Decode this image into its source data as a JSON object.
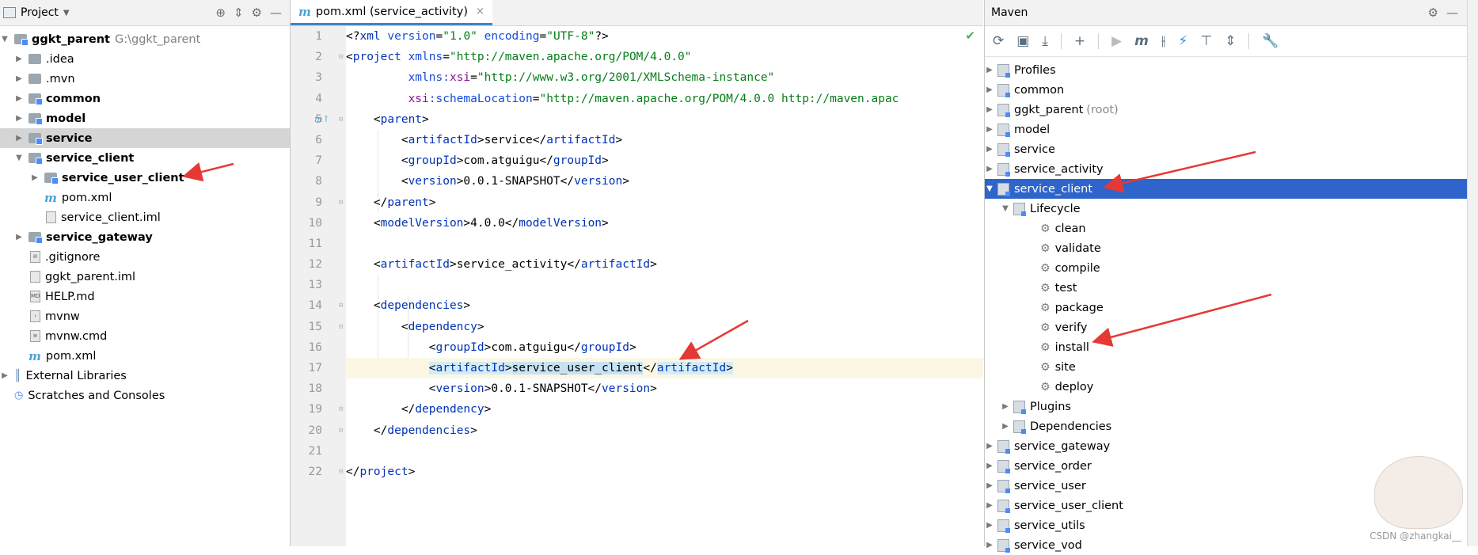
{
  "project": {
    "title": "Project",
    "items": [
      {
        "label": "ggkt_parent",
        "path": "G:\\ggkt_parent"
      },
      {
        "label": ".idea"
      },
      {
        "label": ".mvn"
      },
      {
        "label": "common"
      },
      {
        "label": "model"
      },
      {
        "label": "service"
      },
      {
        "label": "service_client"
      },
      {
        "label": "service_user_client"
      },
      {
        "label": "pom.xml"
      },
      {
        "label": "service_client.iml"
      },
      {
        "label": "service_gateway"
      },
      {
        "label": ".gitignore"
      },
      {
        "label": "ggkt_parent.iml"
      },
      {
        "label": "HELP.md"
      },
      {
        "label": "mvnw"
      },
      {
        "label": "mvnw.cmd"
      },
      {
        "label": "pom.xml"
      },
      {
        "label": "External Libraries"
      },
      {
        "label": "Scratches and Consoles"
      }
    ]
  },
  "editor": {
    "tab_label": "pom.xml (service_activity)",
    "line_numbers": [
      "1",
      "2",
      "3",
      "4",
      "5",
      "6",
      "7",
      "8",
      "9",
      "10",
      "11",
      "12",
      "13",
      "14",
      "15",
      "16",
      "17",
      "18",
      "19",
      "20",
      "21",
      "22"
    ]
  },
  "maven": {
    "title": "Maven",
    "items": [
      {
        "label": "Profiles"
      },
      {
        "label": "common"
      },
      {
        "label": "ggkt_parent",
        "suffix": "(root)"
      },
      {
        "label": "model"
      },
      {
        "label": "service"
      },
      {
        "label": "service_activity"
      },
      {
        "label": "service_client"
      },
      {
        "label": "Lifecycle"
      },
      {
        "label": "clean"
      },
      {
        "label": "validate"
      },
      {
        "label": "compile"
      },
      {
        "label": "test"
      },
      {
        "label": "package"
      },
      {
        "label": "verify"
      },
      {
        "label": "install"
      },
      {
        "label": "site"
      },
      {
        "label": "deploy"
      },
      {
        "label": "Plugins"
      },
      {
        "label": "Dependencies"
      },
      {
        "label": "service_gateway"
      },
      {
        "label": "service_order"
      },
      {
        "label": "service_user"
      },
      {
        "label": "service_user_client"
      },
      {
        "label": "service_utils"
      },
      {
        "label": "service_vod"
      }
    ]
  },
  "watermark": "CSDN @zhangkai__",
  "colors": {
    "selection": "#2f65ca",
    "annotation_arrow": "#e53935"
  }
}
